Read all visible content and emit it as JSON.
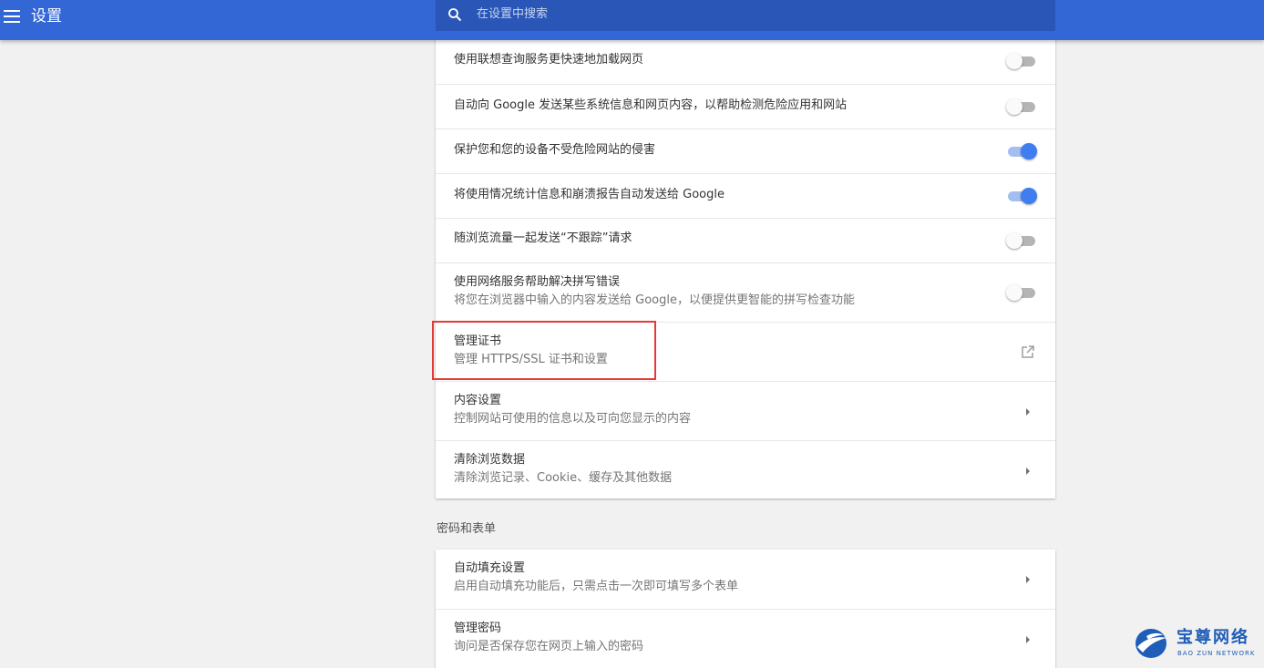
{
  "header": {
    "title": "设置",
    "search_placeholder": "在设置中搜索"
  },
  "privacy_card": {
    "rows": [
      {
        "label": "使用联想查询服务更快速地加载网页",
        "control": "toggle",
        "state": "off"
      },
      {
        "label": "自动向 Google 发送某些系统信息和网页内容，以帮助检测危险应用和网站",
        "control": "toggle",
        "state": "off"
      },
      {
        "label": "保护您和您的设备不受危险网站的侵害",
        "control": "toggle",
        "state": "on"
      },
      {
        "label": "将使用情况统计信息和崩溃报告自动发送给 Google",
        "control": "toggle",
        "state": "on"
      },
      {
        "label": "随浏览流量一起发送“不跟踪”请求",
        "control": "toggle",
        "state": "off"
      },
      {
        "label": "使用网络服务帮助解决拼写错误",
        "sublabel": "将您在浏览器中输入的内容发送给 Google，以便提供更智能的拼写检查功能",
        "control": "toggle",
        "state": "off"
      },
      {
        "label": "管理证书",
        "sublabel": "管理 HTTPS/SSL 证书和设置",
        "control": "external-link"
      },
      {
        "label": "内容设置",
        "sublabel": "控制网站可使用的信息以及可向您显示的内容",
        "control": "arrow"
      },
      {
        "label": "清除浏览数据",
        "sublabel": "清除浏览记录、Cookie、缓存及其他数据",
        "control": "arrow"
      }
    ]
  },
  "passwords_section": {
    "title": "密码和表单",
    "rows": [
      {
        "label": "自动填充设置",
        "sublabel": "启用自动填充功能后，只需点击一次即可填写多个表单",
        "control": "arrow"
      },
      {
        "label": "管理密码",
        "sublabel": "询问是否保存您在网页上输入的密码",
        "control": "arrow"
      }
    ]
  },
  "watermark": {
    "name_cn": "宝尊网络",
    "name_en": "BAO ZUN NETWORK"
  },
  "colors": {
    "header": "#3367d6",
    "toggle_on": "#3f7ef0",
    "highlight": "#e53935",
    "watermark": "#1e5db8"
  }
}
